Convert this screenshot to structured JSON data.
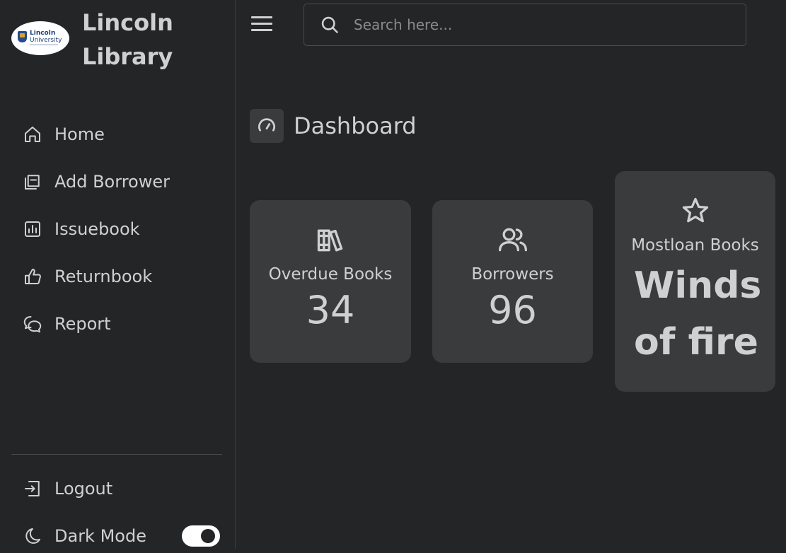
{
  "brand": {
    "name": "Lincoln Library",
    "logo_line1": "Lincoln",
    "logo_line2": "University"
  },
  "sidebar": {
    "items": [
      {
        "label": "Home",
        "icon": "home-icon"
      },
      {
        "label": "Add Borrower",
        "icon": "files-icon"
      },
      {
        "label": "Issuebook",
        "icon": "bar-chart-icon"
      },
      {
        "label": "Returnbook",
        "icon": "thumbs-up-icon"
      },
      {
        "label": "Report",
        "icon": "chat-bubbles-icon"
      }
    ],
    "logout": "Logout",
    "dark_mode": "Dark Mode",
    "dark_mode_on": true
  },
  "search": {
    "placeholder": "Search here..."
  },
  "dashboard": {
    "title": "Dashboard"
  },
  "cards": [
    {
      "label": "Overdue Books",
      "value": "34",
      "icon": "books-icon"
    },
    {
      "label": "Borrowers",
      "value": "96",
      "icon": "users-icon"
    },
    {
      "label": "Mostloan Books",
      "value": "Winds of fire",
      "icon": "star-icon"
    }
  ],
  "colors": {
    "background": "#242526",
    "card": "#3a3b3c",
    "text": "#cfd0d1",
    "toggle": "#ffffff"
  }
}
